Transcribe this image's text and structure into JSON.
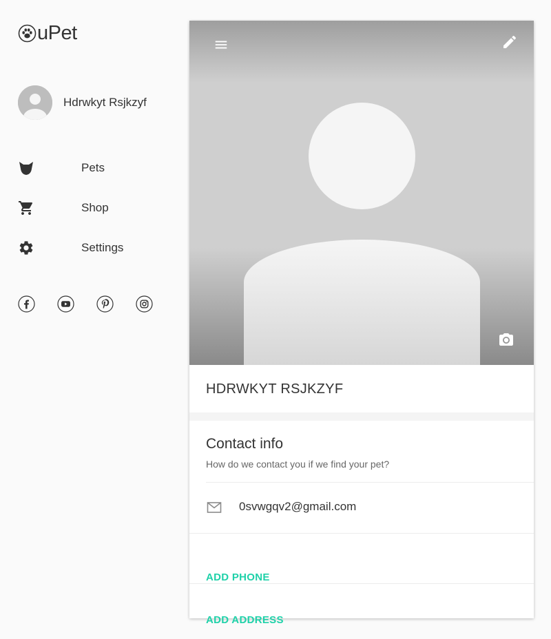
{
  "app": {
    "logo_text": "uPet"
  },
  "user": {
    "name": "Hdrwkyt Rsjkzyf"
  },
  "nav": {
    "items": [
      {
        "label": "Pets",
        "icon": "dog-face-icon"
      },
      {
        "label": "Shop",
        "icon": "shopping-cart-icon"
      },
      {
        "label": "Settings",
        "icon": "gear-icon"
      }
    ]
  },
  "social": [
    "facebook-icon",
    "youtube-icon",
    "pinterest-icon",
    "instagram-icon"
  ],
  "profile": {
    "name_upper": "HDRWKYT RSJKZYF"
  },
  "contact": {
    "title": "Contact info",
    "subtitle": "How do we contact you if we find your pet?",
    "email": "0svwgqv2@gmail.com",
    "add_phone_label": "ADD PHONE",
    "add_address_label": "ADD ADDRESS"
  },
  "colors": {
    "accent": "#1fd1a9",
    "text": "#333333",
    "background": "#fafafa"
  }
}
